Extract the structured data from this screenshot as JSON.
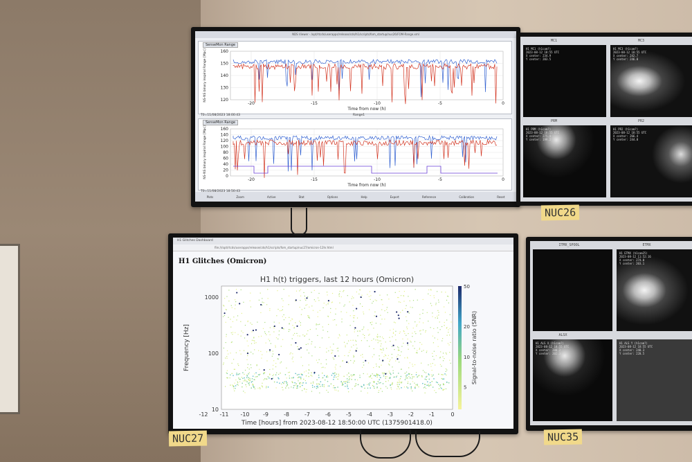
{
  "scene": {
    "wall_color": "#c9b8a6"
  },
  "monitor_top_left": {
    "window_title": "NDS Viewer - /opt/rtcds/userapps/release/cds/h1/scripts/fom_startup/nuc26/FOM-Range.xml",
    "panel1": {
      "tag": "SenseMon Range",
      "ylabel": "NS-NS binary inspiral Range [Mpc]",
      "xlabel": "Time from now (h)",
      "yticks": [
        "160",
        "150",
        "140",
        "130",
        "120"
      ],
      "xticks": [
        "-20",
        "-15",
        "-10",
        "-5",
        "0"
      ],
      "timestamp": "T0=11/08/2023 18:00:43",
      "legend": "Range1"
    },
    "panel2": {
      "tag": "SenseMon Range",
      "ylabel": "NS-NS binary inspiral Range [Mpc]",
      "xlabel": "Time from now (h)",
      "yticks": [
        "160",
        "140",
        "120",
        "100",
        "80",
        "60",
        "40",
        "20",
        "0"
      ],
      "xticks": [
        "-20",
        "-15",
        "-10",
        "-5",
        "0"
      ],
      "timestamp": "T0=11/08/2023 18:50:43",
      "legend": "Range1"
    },
    "status_items": [
      "Plots",
      "Zoom",
      "Active",
      "Stat",
      "Options",
      "Help",
      "Export",
      "Reference",
      "Calibration",
      "Reset"
    ],
    "colors": {
      "blue": "#2f5fd0",
      "red": "#d2331f",
      "purple": "#6a3fd6"
    }
  },
  "monitor_top_right": {
    "cameras": [
      {
        "label": "MC1",
        "info": "H1 MC1 (h1cam?)\n2023-08-12 18:55 UTC\nX center: 234.9\nY center: 203.5"
      },
      {
        "label": "MC3",
        "info": "H1 MC3 (h1cam?)\n2023-08-12 18:55 UTC\nX center: 242.7\nY center: 246.8"
      },
      {
        "label": "PRM",
        "info": "H1 PRM (h1cam?)\n2023-08-12 18:55 UTC\nX center: 275.4\nY center: 199.2"
      },
      {
        "label": "PR2",
        "info": "H1 PR2 (h1cam?)\n2023-08-12 18:55 UTC\nX center: 266.4\nY center: 244.8"
      }
    ]
  },
  "monitor_bottom_left": {
    "tab_title": "H1 Glitches Dashboard",
    "url": "file:///opt/rtcds/userapps/release/cds/h1/scripts/fom_startup/nuc27/omicron-12hr.html",
    "page_heading": "H1 Glitches (Omicron)",
    "chart_title": "H1 h(t) triggers, last 12 hours (Omicron)",
    "ylabel": "Frequency [Hz]",
    "xlabel": "Time [hours] from 2023-08-12 18:50:00 UTC (1375901418.0)",
    "colorbar_label": "Signal-to-noise ratio (SNR)",
    "yticks": [
      "1000",
      "100",
      "10"
    ],
    "xticks": [
      "-12",
      "-11",
      "-10",
      "-9",
      "-8",
      "-7",
      "-6",
      "-5",
      "-4",
      "-3",
      "-2",
      "-1",
      "0"
    ],
    "cbar_ticks": [
      "50",
      "20",
      "10",
      "5"
    ]
  },
  "monitor_bottom_right": {
    "cameras": [
      {
        "label": "ITMX_SPOOL",
        "info": ""
      },
      {
        "label": "ETMX",
        "info": "H1 ETMX (h1cam25)\n2023-08-12 11:52:16\nX center: 274.0\nY center: 203.1"
      },
      {
        "label": "ALSX",
        "info": "H1 ALS X (h1cam?)\n2023-08-12 18:55 UTC\nX center: 200.2\nY center: 202.3"
      },
      {
        "label": "",
        "info": "H1 ALS Y (h1cam?)\n2023-08-12 18:55 UTC\nX center: 240.3\nY center: 220.5"
      }
    ]
  },
  "labels": {
    "nuc26": "NUC26",
    "nuc27": "NUC27",
    "nuc35": "NUC35"
  }
}
